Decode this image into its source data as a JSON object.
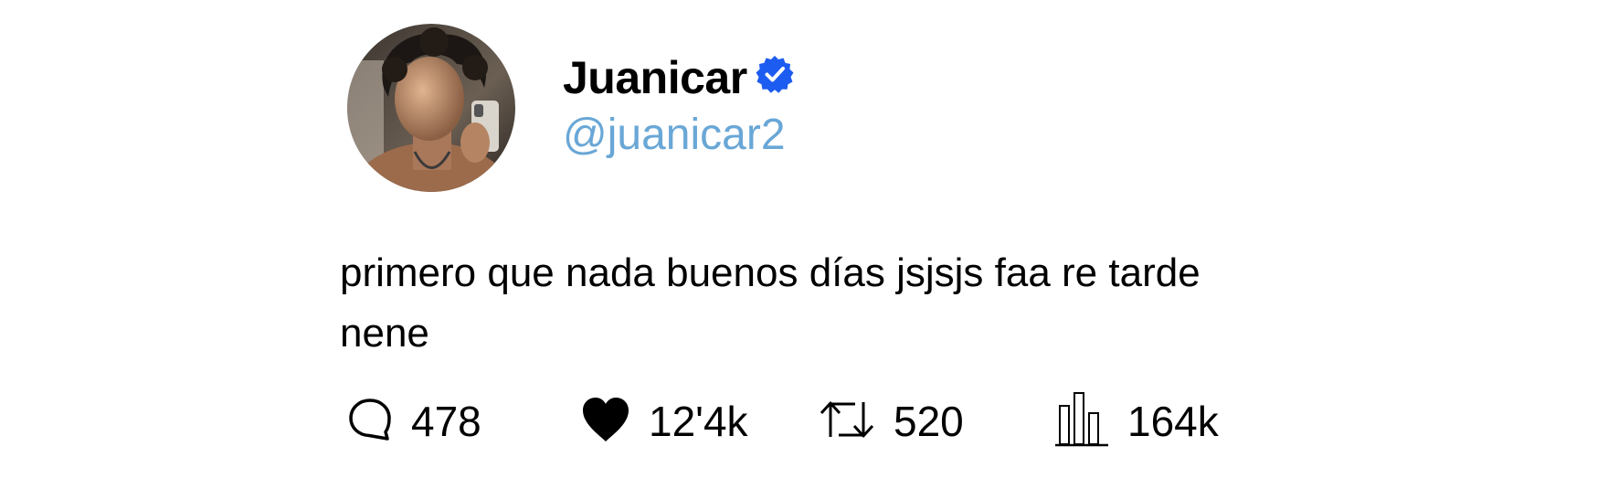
{
  "tweet": {
    "author": {
      "display_name": "Juanicar",
      "handle": "@juanicar2",
      "verified": true,
      "avatar_icon": "profile-photo",
      "verified_icon": "verified-badge-icon"
    },
    "text": "primero que nada buenos días jsjsjs faa re tarde nene",
    "stats": {
      "replies": "478",
      "likes": "12'4k",
      "retweets": "520",
      "views": "164k"
    },
    "icons": {
      "reply": "speech-bubble-icon",
      "like": "heart-icon",
      "retweet": "retweet-icon",
      "views": "bar-chart-icon"
    },
    "colors": {
      "handle": "#69a7d6",
      "verified": "#1d5cf0",
      "text": "#000000",
      "background": "#ffffff"
    }
  }
}
